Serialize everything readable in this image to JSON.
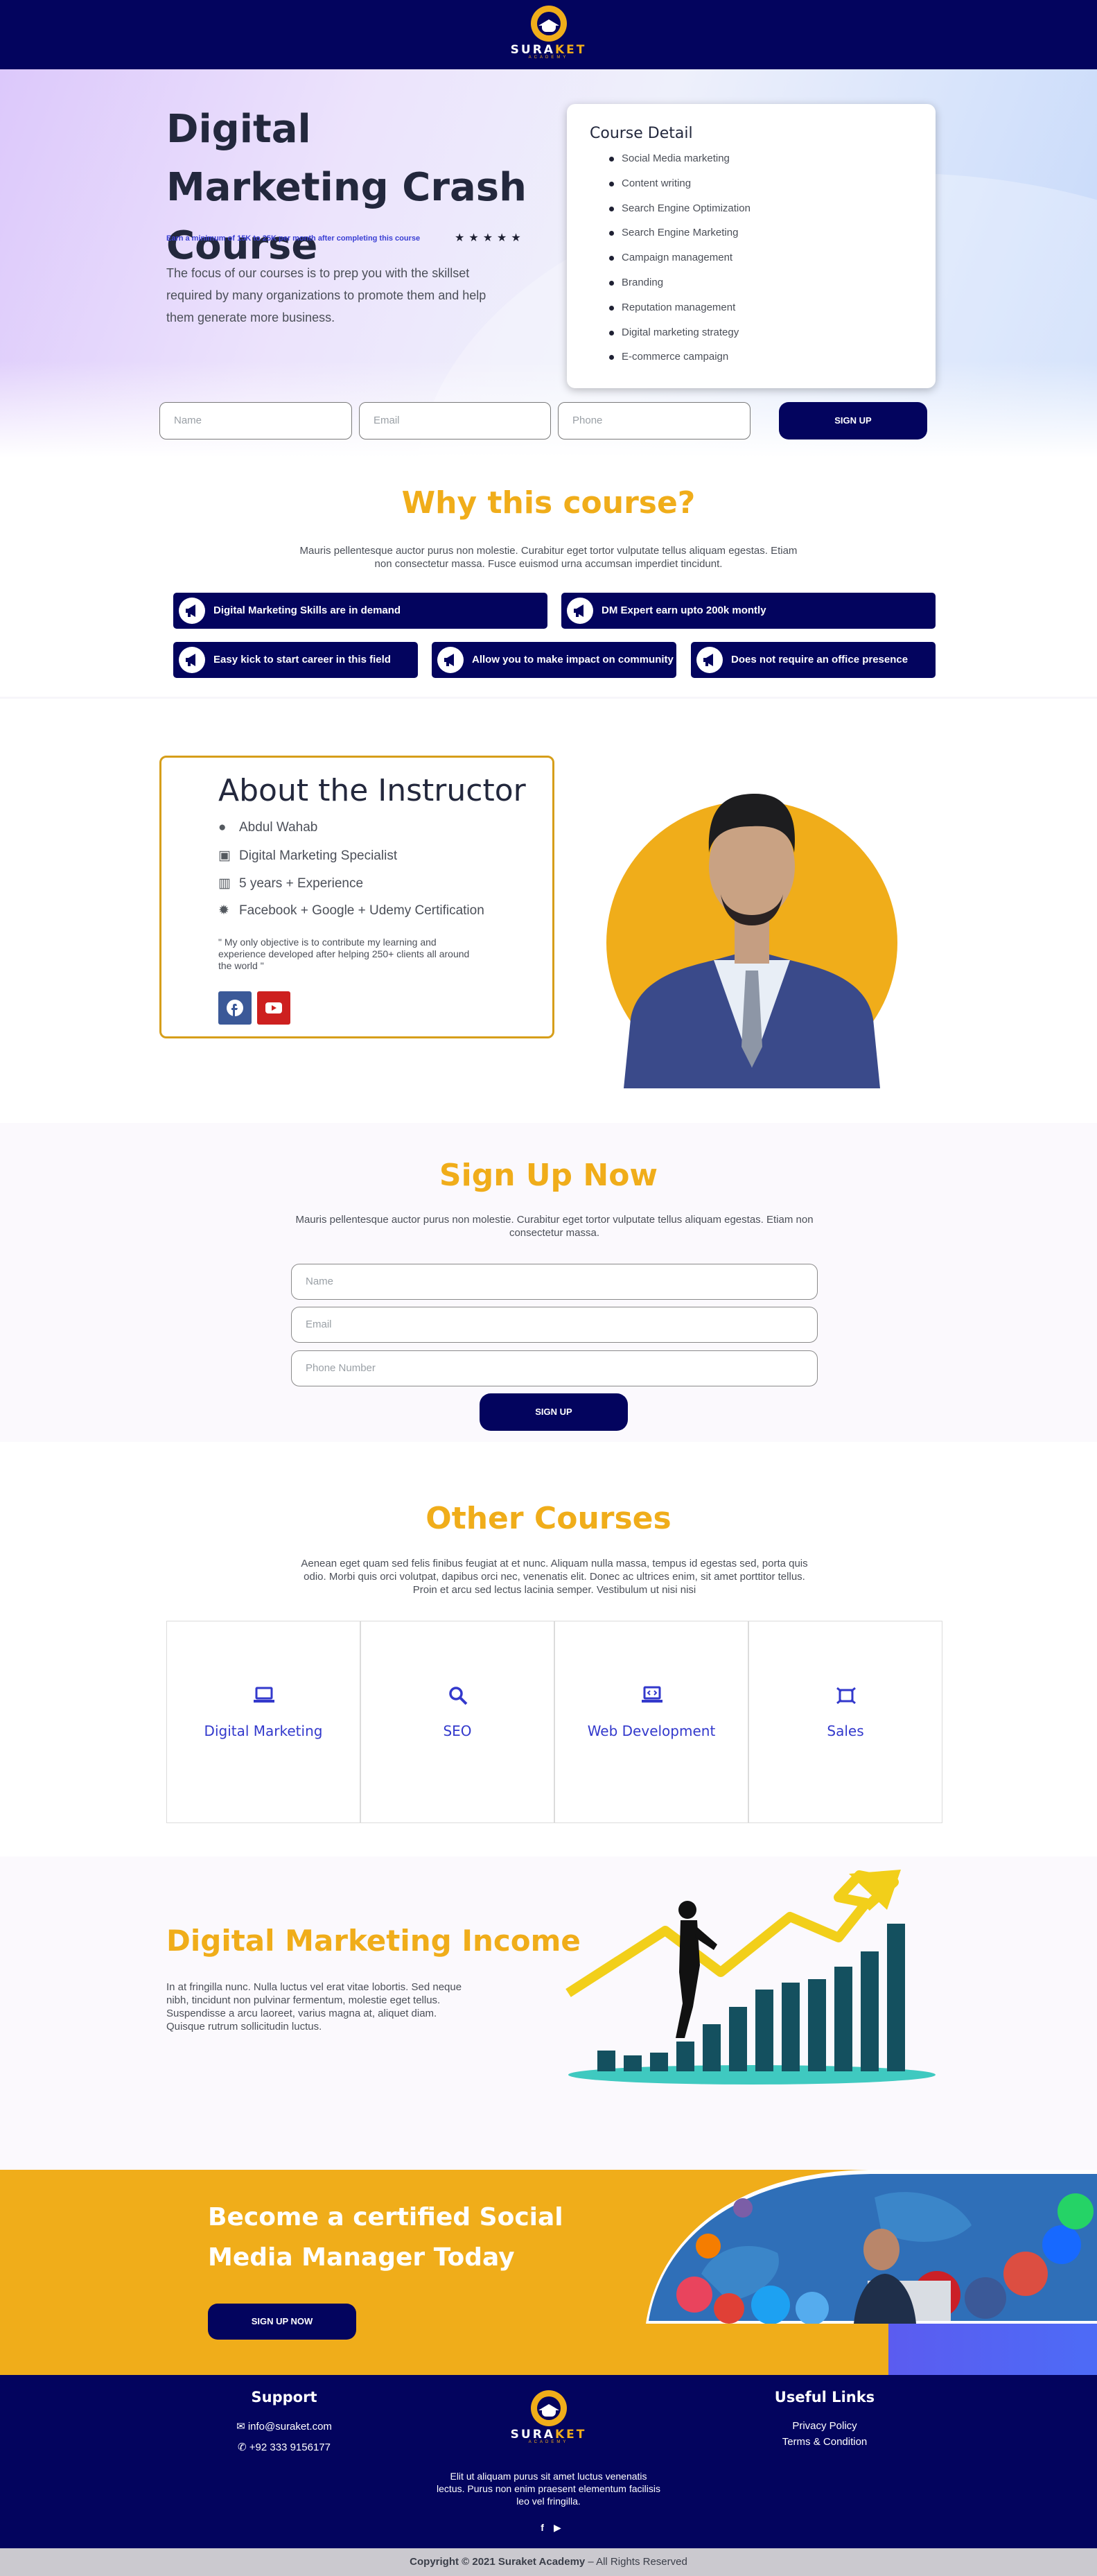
{
  "header": {
    "logo_text_a": "SURA",
    "logo_text_b": "KET",
    "logo_sub": "ACADEMY"
  },
  "hero": {
    "title": "Digital Marketing Crash Course",
    "earn": "Earn a minimum of 15K to 25K per month after completing this course",
    "stars": "★★★★★",
    "description": "The focus of our courses is to prep you with the skillset required by many organizations to promote them and help them generate more business."
  },
  "course_detail": {
    "title": "Course Detail",
    "items": [
      "Social Media marketing",
      "Content writing",
      "Search Engine Optimization",
      "Search Engine Marketing",
      "Campaign management",
      "Branding",
      "Reputation management",
      "Digital marketing strategy",
      "E-commerce campaign"
    ]
  },
  "top_form": {
    "name_placeholder": "Name",
    "email_placeholder": "Email",
    "phone_placeholder": "Phone",
    "button": "SIGN UP"
  },
  "why": {
    "title": "Why this course?",
    "text": "Mauris pellentesque auctor purus non molestie. Curabitur eget tortor vulputate tellus aliquam egestas. Etiam non consectetur massa. Fusce euismod urna accumsan imperdiet tincidunt.",
    "pills": [
      "Digital Marketing Skills are in demand",
      "DM Expert earn upto 200k montly",
      "Easy kick to start career in this field",
      "Allow you to make impact on community",
      "Does not require an office presence"
    ]
  },
  "about": {
    "title": "About the Instructor",
    "name": "Abdul Wahab",
    "role": "Digital Marketing Specialist",
    "experience": "5 years + Experience",
    "certification": "Facebook + Google + Udemy Certification",
    "quote": "\" My only objective is to contribute my learning and experience developed after helping 250+ clients all around the world \""
  },
  "signup": {
    "title": "Sign Up Now",
    "text": "Mauris pellentesque auctor purus non molestie. Curabitur eget tortor vulputate tellus aliquam egestas. Etiam non consectetur massa.",
    "name_placeholder": "Name",
    "email_placeholder": "Email",
    "phone_placeholder": "Phone Number",
    "button": "SIGN UP"
  },
  "other": {
    "title": "Other Courses",
    "text": "Aenean eget quam sed felis finibus feugiat at et nunc. Aliquam nulla massa, tempus id egestas sed, porta quis odio. Morbi quis orci volutpat, dapibus orci nec, venenatis elit. Donec ac ultrices enim, sit amet porttitor tellus. Proin et arcu sed lectus lacinia semper. Vestibulum ut nisi nisi",
    "courses": [
      {
        "label": "Digital Marketing",
        "icon": "laptop-icon"
      },
      {
        "label": "SEO",
        "icon": "search-icon"
      },
      {
        "label": "Web Development",
        "icon": "code-laptop-icon"
      },
      {
        "label": "Sales",
        "icon": "sales-icon"
      }
    ]
  },
  "income": {
    "title": "Digital Marketing Income",
    "text": "In at fringilla nunc. Nulla luctus vel erat vitae lobortis. Sed neque nibh, tincidunt non pulvinar fermentum, molestie eget tellus. Suspendisse a arcu laoreet, varius magna at, aliquet diam. Quisque rutrum sollicitudin luctus."
  },
  "social": {
    "title": "Become a certified Social Media Manager Today",
    "button": "SIGN UP NOW"
  },
  "footer": {
    "support_title": "Support",
    "email": "info@suraket.com",
    "phone": "+92 333 9156177",
    "links_title": "Useful Links",
    "links": [
      "Privacy Policy",
      "Terms & Condition"
    ],
    "about": "Elit ut aliquam purus sit amet luctus venenatis lectus. Purus non enim praesent elementum facilisis leo vel fringilla.",
    "copyright_a": "Copyright © 2021 Suraket Academy",
    "copyright_b": " – All Rights Reserved"
  },
  "colors": {
    "navy": "#03045e",
    "accent": "#f0ad1a",
    "link_blue": "#3339cc"
  }
}
